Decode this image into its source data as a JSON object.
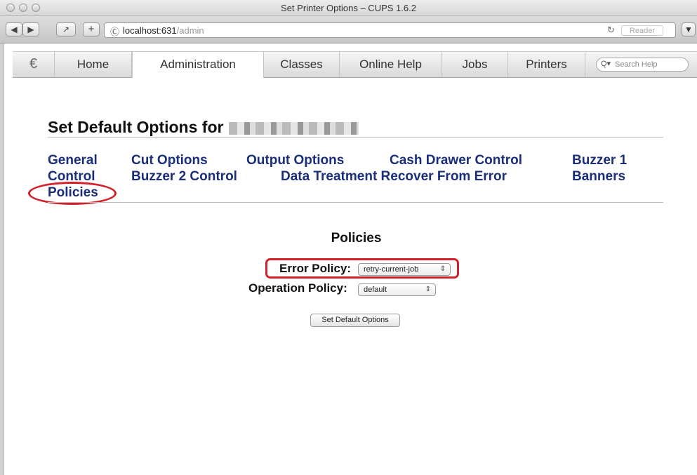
{
  "window": {
    "title": "Set Printer Options – CUPS 1.6.2"
  },
  "browser": {
    "back_icon": "back-arrow-icon",
    "forward_icon": "forward-arrow-icon",
    "share_icon": "share-icon",
    "new_tab_label": "+",
    "url_host": "localhost:631",
    "url_path": "/admin",
    "reader_label": "Reader"
  },
  "cups_nav": {
    "tabs": [
      {
        "label": "Home"
      },
      {
        "label": "Administration"
      },
      {
        "label": "Classes"
      },
      {
        "label": "Online Help"
      },
      {
        "label": "Jobs"
      },
      {
        "label": "Printers"
      }
    ],
    "active_tab": "Administration",
    "search_placeholder": "Search Help"
  },
  "page": {
    "title": "Set Default Options for",
    "title_suffix_redacted": true,
    "option_links": [
      {
        "label": "General"
      },
      {
        "label": "Cut Options"
      },
      {
        "label": "Output Options"
      },
      {
        "label": "Cash Drawer Control"
      },
      {
        "label": "Buzzer 1"
      },
      {
        "label": "Control"
      },
      {
        "label": "Buzzer 2 Control"
      },
      {
        "label": "Data Treatment Recover From Error"
      },
      {
        "label": "Banners"
      },
      {
        "label": "Policies"
      }
    ],
    "section_title": "Policies",
    "error_policy": {
      "label": "Error Policy:",
      "value": "retry-current-job"
    },
    "operation_policy": {
      "label": "Operation Policy:",
      "value": "default"
    },
    "submit_label": "Set Default Options"
  },
  "annotations": {
    "highlight_color": "#d4202a"
  }
}
